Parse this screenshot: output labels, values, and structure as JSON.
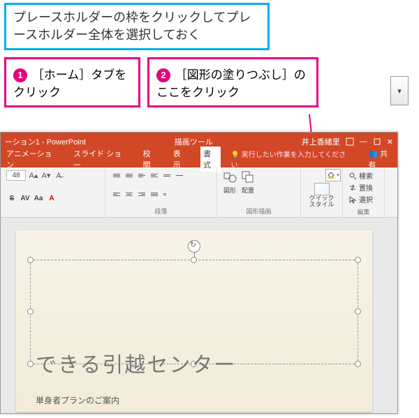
{
  "instruction": "プレースホルダーの枠をクリックしてプレースホルダー全体を選択しておく",
  "callouts": {
    "one": {
      "num": "1",
      "text": "［ホーム］タブをクリック"
    },
    "two": {
      "num": "2",
      "text": "［図形の塗りつぶし］のここをクリック"
    }
  },
  "titlebar": {
    "doc": "ーション1 - PowerPoint",
    "tool_context": "描画ツール",
    "user": "井上香緒里"
  },
  "tabs": {
    "animation": "アニメーション",
    "slideshow": "スライド ショー",
    "review": "校閲",
    "view": "表示",
    "format": "書式",
    "hint": "実行したい作業を入力してください",
    "share": "共有"
  },
  "ribbon": {
    "font_size": "48",
    "group_paragraph": "段落",
    "group_drawing": "図形描画",
    "group_edit": "編集",
    "shapes": "図形",
    "arrange": "配置",
    "quick_style": "クイック\nスタイル",
    "find": "検索",
    "replace": "置換",
    "select": "選択"
  },
  "slide": {
    "title": "できる引越センター",
    "subtitle": "単身者プランのご案内"
  }
}
